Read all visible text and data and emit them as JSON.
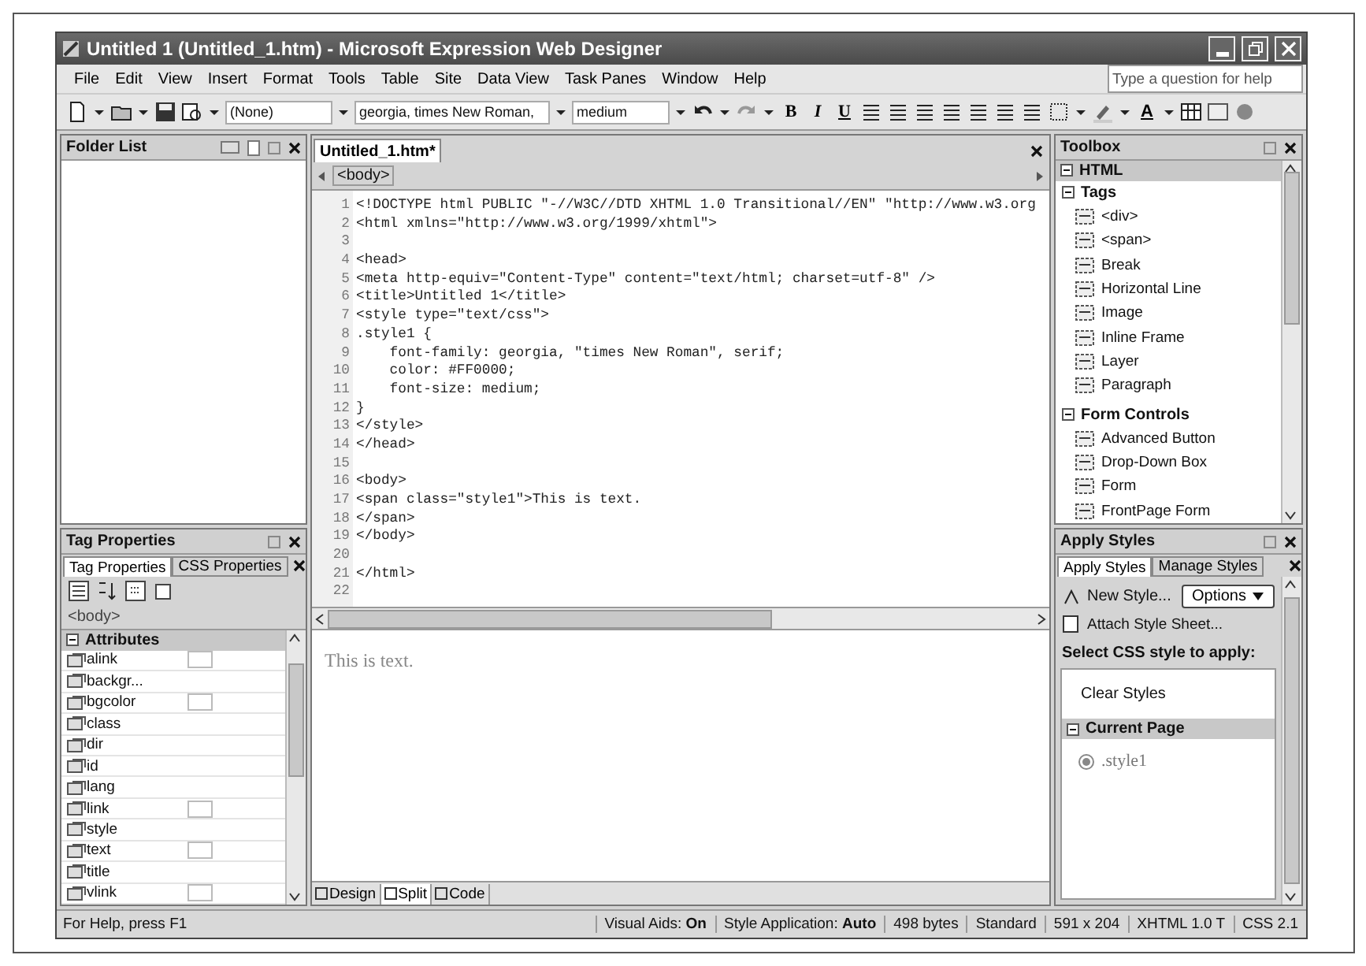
{
  "window": {
    "title": "Untitled 1 (Untitled_1.htm) - Microsoft Expression Web Designer"
  },
  "menu": [
    "File",
    "Edit",
    "View",
    "Insert",
    "Format",
    "Tools",
    "Table",
    "Site",
    "Data View",
    "Task Panes",
    "Window",
    "Help"
  ],
  "help_box": {
    "placeholder": "Type a question for help"
  },
  "toolbar": {
    "style_box": "(None)",
    "font_box": "georgia, times New Roman,",
    "size_box": "medium",
    "format_buttons": [
      "B",
      "I",
      "U"
    ],
    "font_color": "A"
  },
  "folder_list": {
    "title": "Folder List"
  },
  "tag_properties": {
    "title": "Tag Properties",
    "tabs": [
      {
        "label": "Tag Properties",
        "selected": true
      },
      {
        "label": "CSS Properties",
        "selected": false
      }
    ],
    "tag": "<body>",
    "section": "Attributes",
    "attributes": [
      {
        "name": "alink",
        "color_box": true
      },
      {
        "name": "backgr...",
        "color_box": false
      },
      {
        "name": "bgcolor",
        "color_box": true
      },
      {
        "name": "class",
        "color_box": false
      },
      {
        "name": "dir",
        "color_box": false
      },
      {
        "name": "id",
        "color_box": false
      },
      {
        "name": "lang",
        "color_box": false
      },
      {
        "name": "link",
        "color_box": true
      },
      {
        "name": "style",
        "color_box": false
      },
      {
        "name": "text",
        "color_box": true
      },
      {
        "name": "title",
        "color_box": false
      },
      {
        "name": "vlink",
        "color_box": true
      }
    ]
  },
  "editor": {
    "tab": "Untitled_1.htm*",
    "breadcrumb": "<body>",
    "lines": [
      {
        "number": "1",
        "text": "<!DOCTYPE html PUBLIC \"-//W3C//DTD XHTML 1.0 Transitional//EN\" \"http://www.w3.org"
      },
      {
        "number": "2",
        "text": "<html xmlns=\"http://www.w3.org/1999/xhtml\">"
      },
      {
        "number": "3"
      },
      {
        "number": "4",
        "text": "<head>"
      },
      {
        "number": "5",
        "text": "<meta http-equiv=\"Content-Type\" content=\"text/html; charset=utf-8\" />"
      },
      {
        "number": "6",
        "text": "<title>Untitled 1</title>"
      },
      {
        "number": "7",
        "text": "<style type=\"text/css\">"
      },
      {
        "number": "8",
        "text": ".style1 {"
      },
      {
        "number": "9",
        "text": "    font-family: georgia, \"times New Roman\", serif;"
      },
      {
        "number": "10",
        "text": "    color: #FF0000;"
      },
      {
        "number": "11",
        "text": "    font-size: medium;"
      },
      {
        "number": "12",
        "text": "}"
      },
      {
        "number": "13",
        "text": "</style>"
      },
      {
        "number": "14",
        "text": "</head>"
      },
      {
        "number": "15"
      },
      {
        "number": "16",
        "text": "<body>"
      },
      {
        "number": "17",
        "text": "<span class=\"style1\">This is text."
      },
      {
        "number": "18",
        "text": "</span>"
      },
      {
        "number": "19",
        "text": "</body>"
      },
      {
        "number": "20"
      },
      {
        "number": "21",
        "text": "</html>"
      },
      {
        "number": "22"
      }
    ],
    "design_text": "This is text.",
    "view_tabs": [
      {
        "label": "Design",
        "selected": false
      },
      {
        "label": "Split",
        "selected": true
      },
      {
        "label": "Code",
        "selected": false
      }
    ]
  },
  "toolbox": {
    "title": "Toolbox",
    "header": "HTML",
    "groups": [
      {
        "label": "Tags",
        "items": [
          "<div>",
          "<span>",
          "Break",
          "Horizontal Line",
          "Image",
          "Inline Frame",
          "Layer",
          "Paragraph"
        ]
      },
      {
        "label": "Form Controls",
        "items": [
          "Advanced Button",
          "Drop-Down Box",
          "Form",
          "FrontPage Form"
        ]
      }
    ]
  },
  "apply_styles": {
    "title": "Apply Styles",
    "tabs": [
      {
        "label": "Apply Styles",
        "selected": true
      },
      {
        "label": "Manage Styles",
        "selected": false
      }
    ],
    "new_style": "New Style...",
    "options": "Options",
    "attach": "Attach Style Sheet...",
    "prompt": "Select CSS style to apply:",
    "clear": "Clear Styles",
    "section": "Current Page",
    "styles": [
      ".style1"
    ]
  },
  "status_bar": {
    "help": "For Help, press F1",
    "fields": [
      "Visual Aids: **On**",
      "Style Application: **Auto**",
      "498 bytes",
      "Standard",
      "591 x 204",
      "XHTML 1.0 T",
      "CSS 2.1"
    ]
  }
}
